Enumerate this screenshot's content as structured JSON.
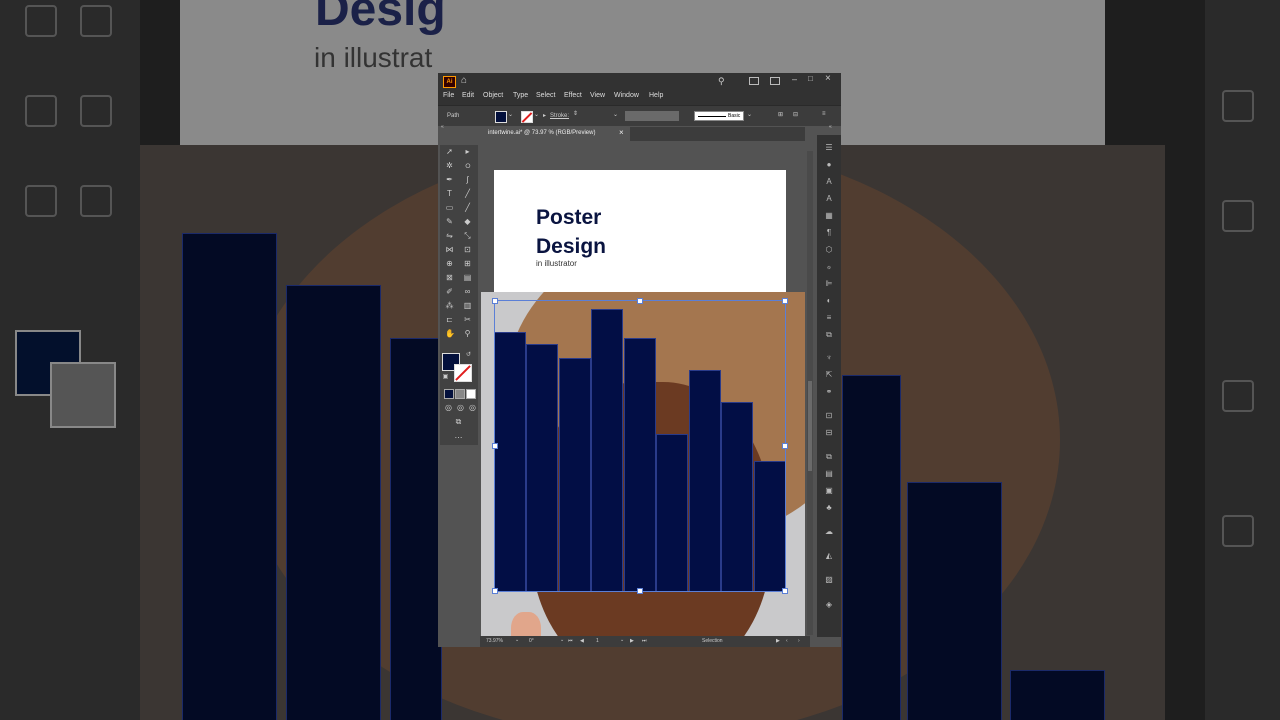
{
  "window": {
    "app_badge": "Ai",
    "menus": [
      "File",
      "Edit",
      "Object",
      "Type",
      "Select",
      "Effect",
      "View",
      "Window",
      "Help"
    ]
  },
  "control_bar": {
    "selection_type": "Path",
    "stroke_label": "Stroke:",
    "brush_style": "Basic"
  },
  "document": {
    "tab_label": "intertwine.ai* @ 73.97 % (RGB/Preview)",
    "close_glyph": "×"
  },
  "artboard": {
    "title_line1": "Poster",
    "title_line2": "Design",
    "subtitle": "in illustrator"
  },
  "status_bar": {
    "zoom": "73.97%",
    "rotation": "0°",
    "artboard_number": "1",
    "tool_name": "Selection"
  },
  "background": {
    "title_partial": "Desig",
    "subtitle_partial": "in illustrat"
  },
  "colors": {
    "fill": "#03103c",
    "bar": "#020e45",
    "ui_dark": "#323232",
    "selection": "#5b7fd6"
  },
  "chart_bars": [
    0.89,
    0.85,
    0.8,
    0.97,
    0.87,
    0.54,
    0.76,
    0.65,
    0.45
  ]
}
